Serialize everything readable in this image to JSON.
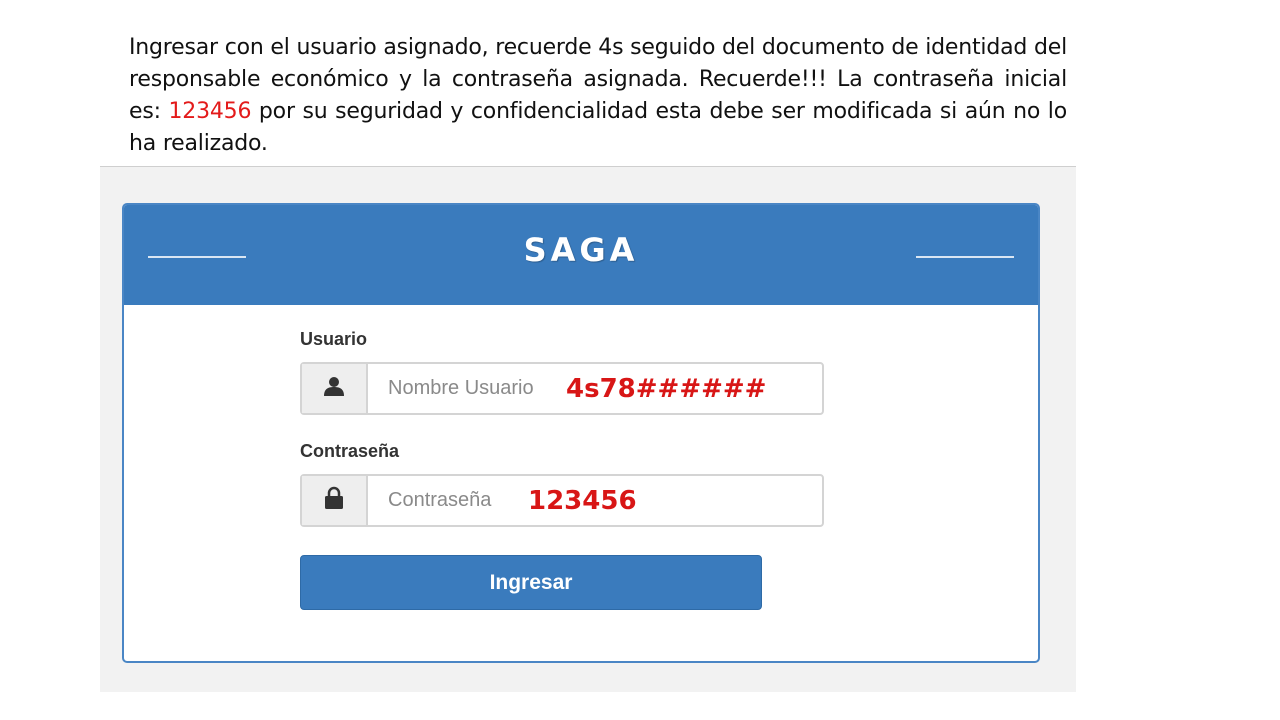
{
  "instructions": {
    "part1": "Ingresar con el usuario asignado, recuerde 4s seguido del documento de identidad del responsable económico y la contraseña asignada. Recuerde!!! La contraseña inicial es: ",
    "password_highlight": "123456",
    "part2": " por su seguridad y confidencialidad esta debe ser modificada si aún no lo ha realizado."
  },
  "login": {
    "title": "SAGA",
    "username_label": "Usuario",
    "username_placeholder": "Nombre Usuario",
    "username_annotation": "4s78######",
    "password_label": "Contraseña",
    "password_placeholder": "Contraseña",
    "password_annotation": "123456",
    "submit_label": "Ingresar"
  },
  "icons": {
    "username": "user-icon",
    "password": "lock-icon"
  },
  "colors": {
    "header": "#3a7bbd",
    "button": "#3a7bbd",
    "annotation": "#d81616"
  }
}
